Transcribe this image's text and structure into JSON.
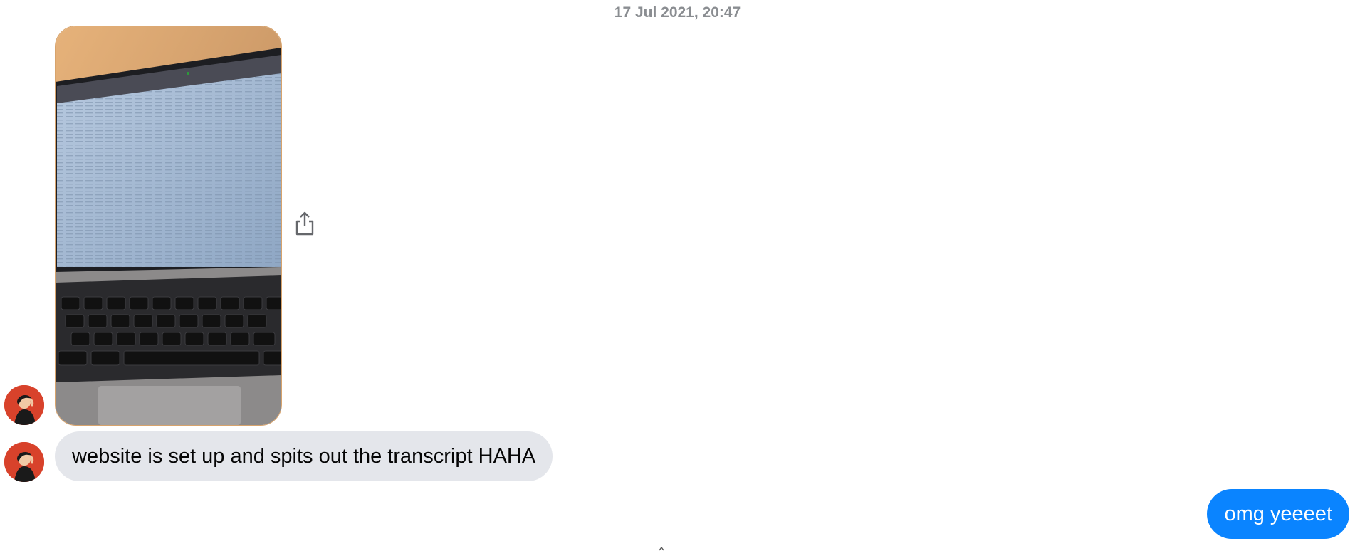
{
  "thread": {
    "timestamp": "17 Jul 2021, 20:47"
  },
  "messages": {
    "incoming_text": "website is set up and spits out the transcript HAHA",
    "outgoing_text": "omg yeeeet"
  },
  "icons": {
    "share": "share-icon",
    "avatar": "contact-avatar",
    "photo": "laptop-photo"
  },
  "colors": {
    "incoming_bubble": "#e4e6eb",
    "outgoing_bubble": "#0a84ff",
    "timestamp": "#8a8d91",
    "avatar_bg": "#d8422b"
  }
}
